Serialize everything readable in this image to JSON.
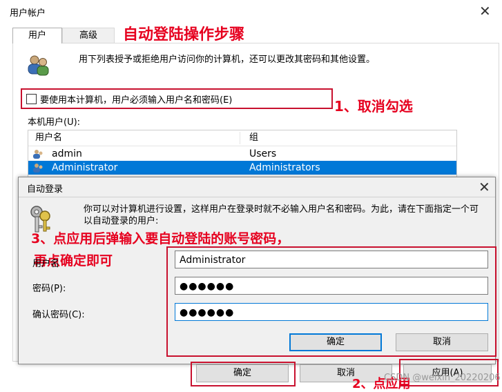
{
  "window": {
    "title": "用户帐户"
  },
  "tabs": [
    {
      "label": "用户"
    },
    {
      "label": "高级"
    }
  ],
  "annotations": {
    "heading": "自动登陆操作步骤",
    "step1": "1、取消勾选",
    "step2": "2、点应用",
    "step3_line1": "3、点应用后弹输入要自动登陆的账号密码，",
    "step3_line2": "再点确定即可"
  },
  "intro_text": "用下列表授予或拒绝用户访问你的计算机，还可以更改其密码和其他设置。",
  "require_password": {
    "label": "要使用本计算机，用户必须输入用户名和密码(E)",
    "checked": false
  },
  "users_label": "本机用户(U):",
  "users_table": {
    "columns": [
      "用户名",
      "组"
    ],
    "rows": [
      {
        "name": "admin",
        "group": "Users"
      },
      {
        "name": "Administrator",
        "group": "Administrators"
      }
    ]
  },
  "main_buttons": {
    "ok": "确定",
    "cancel": "取消",
    "apply": "应用(A)"
  },
  "autologon_dialog": {
    "title": "自动登录",
    "description": "你可以对计算机进行设置，这样用户在登录时就不必输入用户名和密码。为此，请在下面指定一个可以自动登录的用户:",
    "username_label": "用户名",
    "username_value": "Administrator",
    "password_label": "密码(P):",
    "password_value": "●●●●●●",
    "confirm_label": "确认密码(C):",
    "confirm_value": "●●●●●●",
    "ok": "确定",
    "cancel": "取消"
  },
  "watermark": "CSDN @weixin_20220206",
  "colors": {
    "annotation_red": "#e6001f",
    "selection_blue": "#0078d7"
  }
}
